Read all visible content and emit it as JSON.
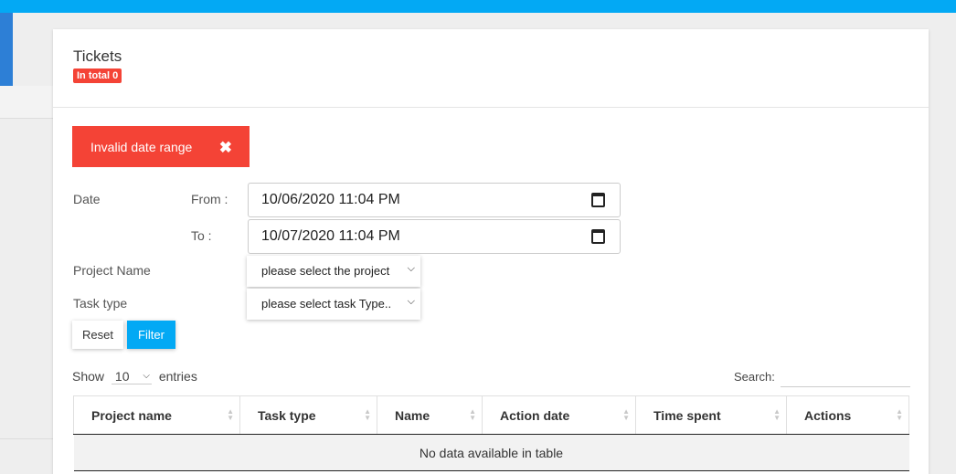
{
  "header": {
    "title": "Tickets",
    "badge": "In total  0"
  },
  "alert": {
    "message": "Invalid date range",
    "close": "✖"
  },
  "filters": {
    "date_label": "Date",
    "from_label": "From :",
    "to_label": "To :",
    "from_value": "10/06/2020 11:04 PM",
    "to_value": "10/07/2020 11:04 PM",
    "project_label": "Project Name",
    "project_value": "please select the project",
    "task_label": "Task type",
    "task_value": "please select task Type..",
    "reset_label": "Reset",
    "filter_label": "Filter"
  },
  "table_controls": {
    "show_label": "Show",
    "entries_value": "10",
    "entries_label": "entries",
    "search_label": "Search:"
  },
  "table": {
    "columns": [
      "Project name",
      "Task type",
      "Name",
      "Action date",
      "Time spent",
      "Actions"
    ],
    "empty_message": "No data available in table"
  },
  "colors": {
    "accent": "#03a9f4",
    "danger": "#f44336"
  }
}
